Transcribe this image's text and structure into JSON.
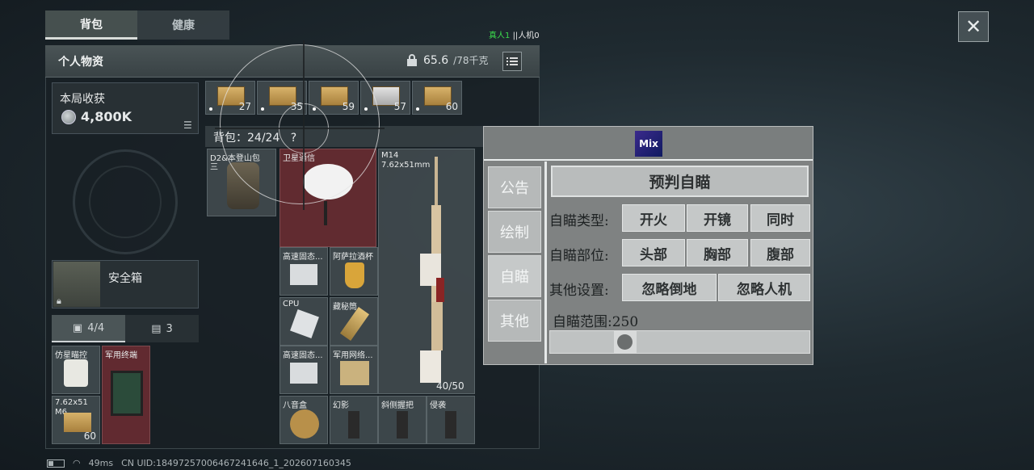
{
  "tabs": [
    "背包",
    "健康"
  ],
  "players": {
    "real": "真人1",
    "sep": "||",
    "bots": "人机0"
  },
  "inventory": {
    "title": "个人物资",
    "weight": "65.6",
    "weight_max": "/78千克",
    "earnings_label": "本局收获",
    "earnings_value": "4,800K",
    "safebox_label": "安全箱",
    "subtab_1": "4/4",
    "subtab_2": "3",
    "bag_label": "背包：24/24",
    "bag_help": "?"
  },
  "ammo_counts": [
    "27",
    "35",
    "59",
    "57",
    "60"
  ],
  "items": {
    "backpack": "D2&本登山包",
    "backpack2": "三",
    "satellite": "卫星通信",
    "rifle_name": "M14",
    "rifle_ammo": "7.62x51mm",
    "ssd1": "高速固态...",
    "goblet": "阿萨拉酒杯",
    "cpu": "CPU",
    "cylinder": "藏秘筒",
    "ssd2": "高速固态...",
    "network": "军用网络...",
    "weapon_count": "40/50",
    "bagua": "八音盒",
    "phantom": "幻影",
    "grip": "斜侧握把",
    "invader": "侵袭",
    "pouch1": "仿星瞄控",
    "pouch2": "军用终端",
    "pouch3_a": "7.62x51",
    "pouch3_b": "M6",
    "pouch3_count": "60"
  },
  "mix_menu": {
    "logo": "Mix",
    "side": [
      "公告",
      "绘制",
      "自瞄",
      "其他"
    ],
    "preaim": "预判自瞄",
    "aim_type_label": "自瞄类型:",
    "aim_type_opts": [
      "开火",
      "开镜",
      "同时"
    ],
    "aim_part_label": "自瞄部位:",
    "aim_part_opts": [
      "头部",
      "胸部",
      "腹部"
    ],
    "other_label": "其他设置:",
    "other_opts": [
      "忽略倒地",
      "忽略人机"
    ],
    "range_label": "自瞄范围:250",
    "range_value": 250
  },
  "status": {
    "ping": "49ms",
    "uid": "CN UID:18497257006467241646_1_202607160345"
  }
}
